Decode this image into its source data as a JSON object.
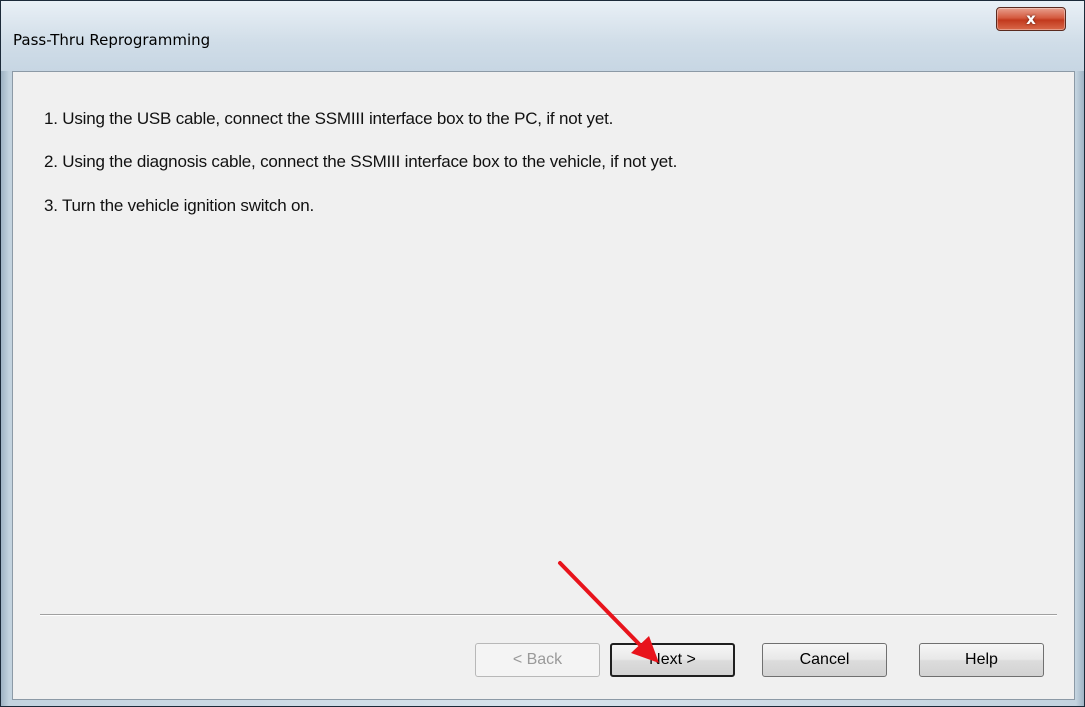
{
  "window": {
    "title": "Pass-Thru Reprogramming",
    "close_glyph": "x"
  },
  "steps": [
    "1. Using the USB cable, connect the SSMIII interface box to the PC, if not yet.",
    "2. Using the diagnosis cable, connect the SSMIII interface box to the vehicle, if not yet.",
    "3. Turn the vehicle ignition switch on."
  ],
  "buttons": {
    "back": "< Back",
    "next": "Next >",
    "cancel": "Cancel",
    "help": "Help"
  },
  "colors": {
    "annotation_arrow": "#e8141c"
  }
}
